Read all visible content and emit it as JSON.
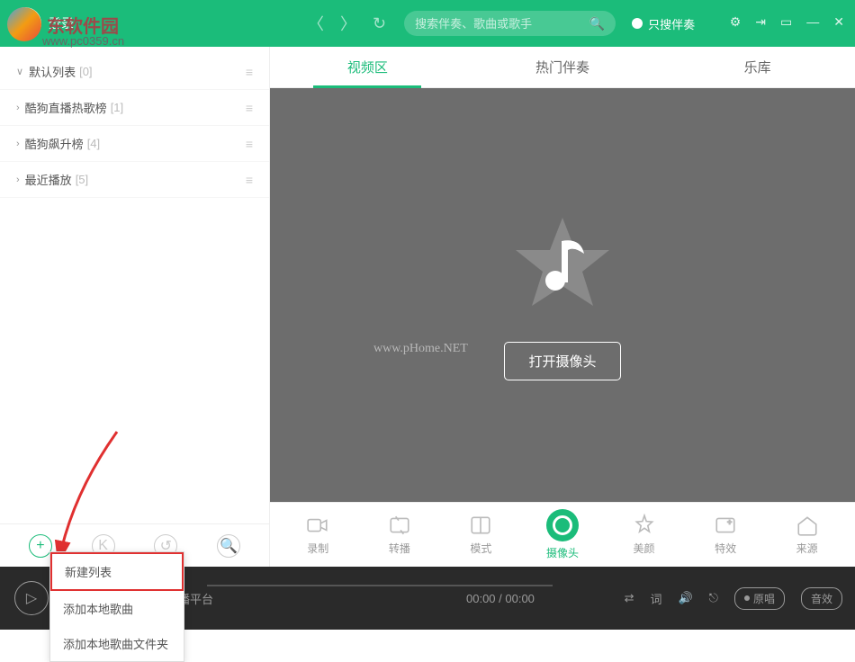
{
  "header": {
    "login": "登录",
    "logo_text": "东软件园",
    "logo_url": "www.pc0359.cn",
    "search_placeholder": "搜索伴奏、歌曲或歌手",
    "accomp_only": "只搜伴奏"
  },
  "sidebar": {
    "items": [
      {
        "label": "默认列表",
        "count": "[0]",
        "expanded": true
      },
      {
        "label": "酷狗直播热歌榜",
        "count": "[1]",
        "expanded": false
      },
      {
        "label": "酷狗飙升榜",
        "count": "[4]",
        "expanded": false
      },
      {
        "label": "最近播放",
        "count": "[5]",
        "expanded": false
      }
    ]
  },
  "tabs": {
    "video": "视频区",
    "hot": "热门伴奏",
    "library": "乐库"
  },
  "video_area": {
    "watermark": "www.pHome.NET",
    "open_camera": "打开摄像头"
  },
  "tools": {
    "record": "录制",
    "relay": "转播",
    "mode": "模式",
    "camera": "摄像头",
    "beauty": "美颜",
    "effects": "特效",
    "source": "来源"
  },
  "player": {
    "track_text": "播，一个真正唱歌的直播平台",
    "time": "00:00 / 00:00",
    "original": "原唱",
    "sound_effect": "音效"
  },
  "context_menu": {
    "new_list": "新建列表",
    "add_local_songs": "添加本地歌曲",
    "add_local_folder": "添加本地歌曲文件夹"
  }
}
